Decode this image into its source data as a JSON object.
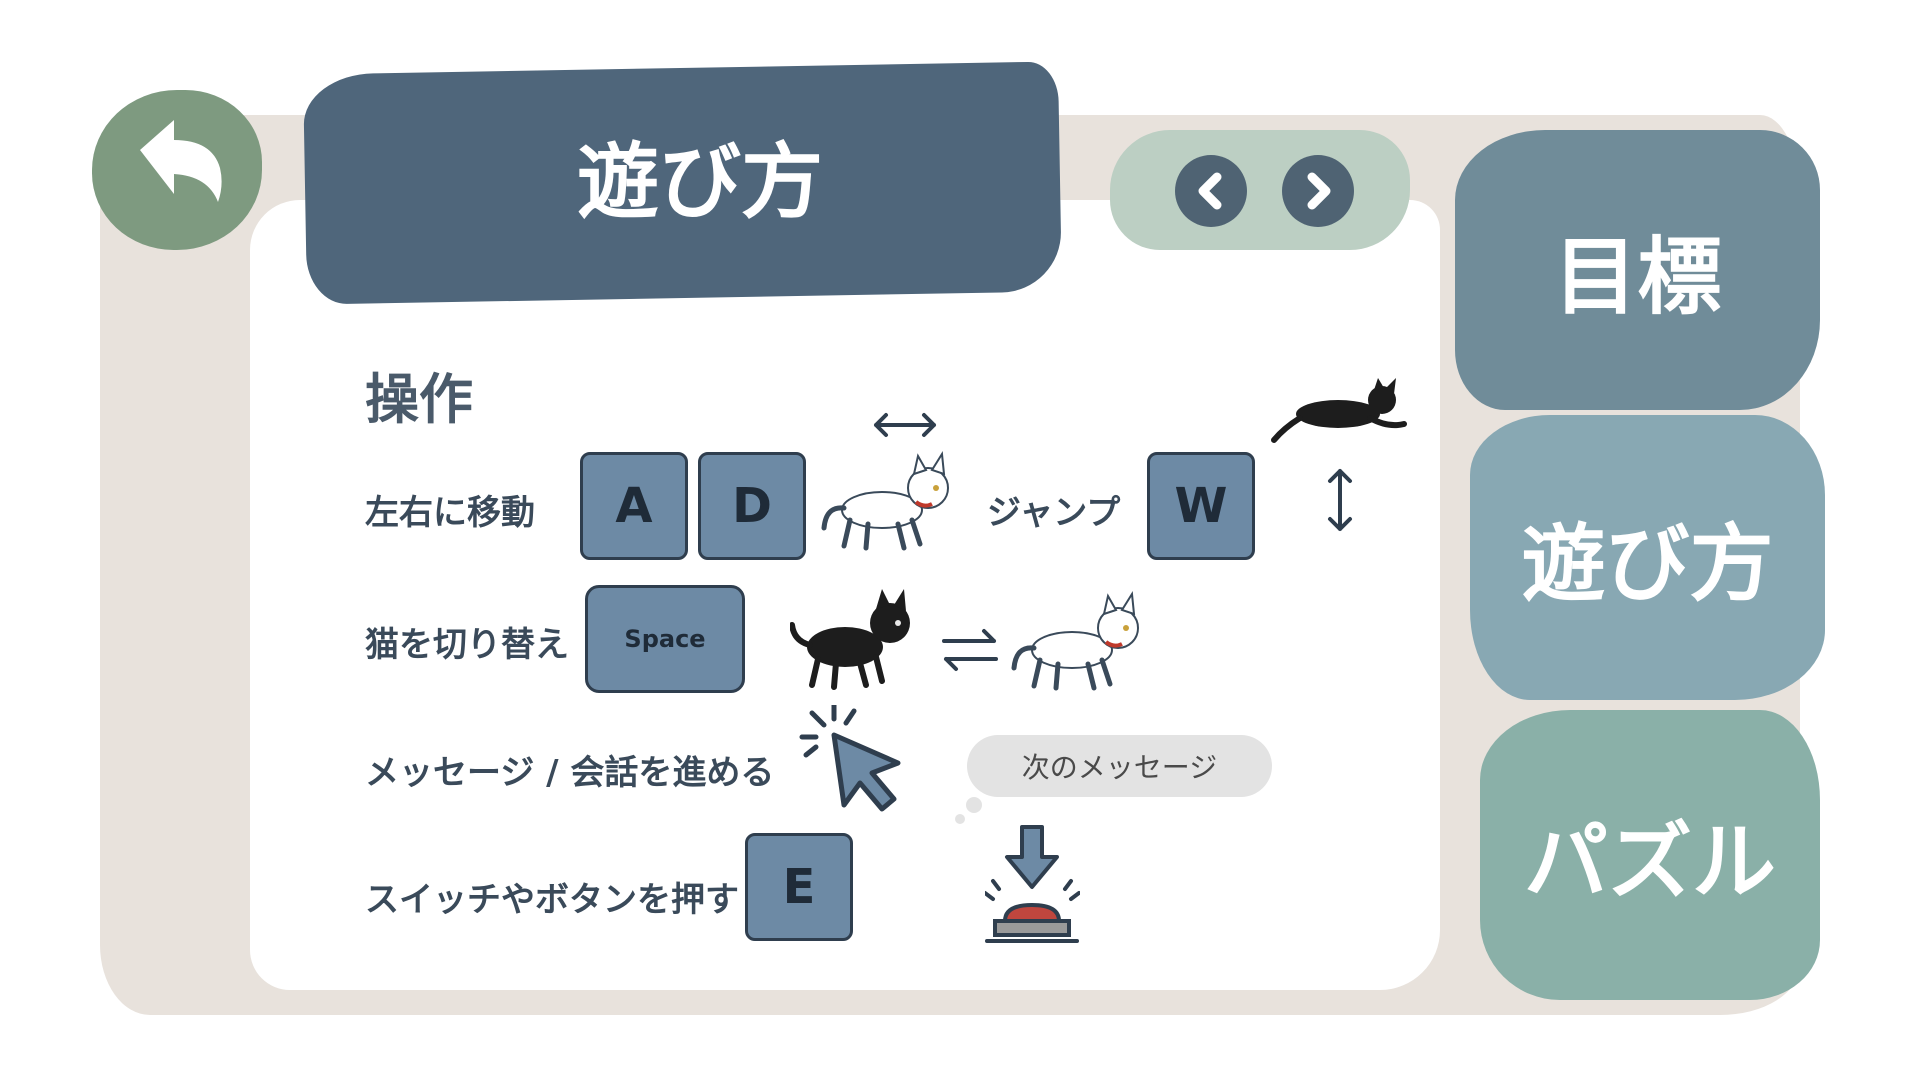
{
  "header": {
    "title": "遊び方"
  },
  "back_button": {
    "icon": "back-arrow-icon"
  },
  "pager": {
    "prev_icon": "chevron-left-icon",
    "next_icon": "chevron-right-icon"
  },
  "tabs": [
    {
      "label": "目標"
    },
    {
      "label": "遊び方"
    },
    {
      "label": "パズル"
    }
  ],
  "controls": {
    "section_title": "操作",
    "move": {
      "label": "左右に移動",
      "keys": [
        "A",
        "D"
      ]
    },
    "jump": {
      "label": "ジャンプ",
      "key": "W"
    },
    "switch": {
      "label": "猫を切り替え",
      "key": "Space"
    },
    "advance": {
      "label": "メッセージ / 会話を進める",
      "bubble": "次のメッセージ"
    },
    "press": {
      "label": "スイッチやボタンを押す",
      "key": "E"
    }
  },
  "colors": {
    "title_bg": "#4f667b",
    "back_bg": "#7e9a80",
    "key_bg": "#6d8aa5",
    "tab_goal": "#708c99",
    "tab_howto": "#88a8b3",
    "tab_puzzle": "#8ab0a8"
  }
}
